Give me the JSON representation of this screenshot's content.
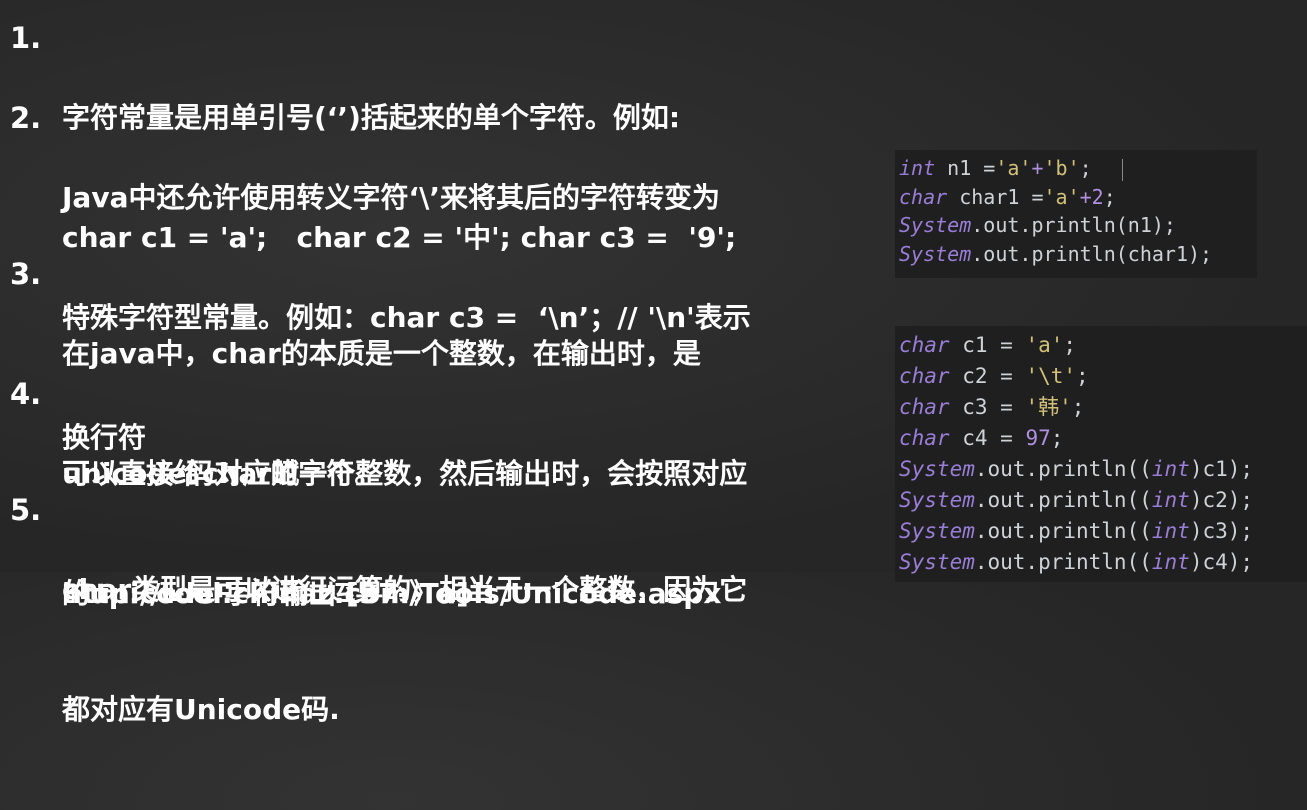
{
  "items": [
    {
      "num": "1.",
      "lines": [
        "字符常量是用单引号(‘’)括起来的单个字符。例如:",
        "char c1 = 'a';   char c2 = '中'; char c3 =  '9';"
      ]
    },
    {
      "num": "2.",
      "lines": [
        "Java中还允许使用转义字符‘\\’来将其后的字符转变为",
        "特殊字符型常量。例如：char c3 =  ‘\\n’；// '\\n'表示",
        "换行符"
      ]
    },
    {
      "num": "3.",
      "lines": [
        "在java中，char的本质是一个整数，在输出时，是",
        "unicode码对应的字符。",
        "http://tool.chinaz.com/Tools/Unicode.aspx"
      ]
    },
    {
      "num": "4.",
      "lines": [
        "可以直接给char赋一个整数，然后输出时，会按照对应",
        "的unicode 字符输出 [97-》a]"
      ]
    },
    {
      "num": "5.",
      "lines": [
        "char类型是可以进行运算的，相当于一个整数，因为它",
        "都对应有Unicode码."
      ]
    }
  ],
  "code_block_1": {
    "l1": {
      "kw": "int",
      "rest1": " n1 =",
      "s1": "'a'",
      "plus": "+",
      "s2": "'b'",
      "end": ";"
    },
    "l2": {
      "kw": "char",
      "rest1": " char1 =",
      "s1": "'a'",
      "plus": "+",
      "n": "2",
      "end": ";"
    },
    "l3": {
      "cls": "System",
      "rest": ".out.println(n1);"
    },
    "l4": {
      "cls": "System",
      "rest": ".out.println(char1);"
    }
  },
  "code_block_2": {
    "decls": [
      {
        "kw": "char",
        "name": " c1 = ",
        "val": "'a'",
        "type": "str"
      },
      {
        "kw": "char",
        "name": " c2 = ",
        "val": "'\\t'",
        "type": "str"
      },
      {
        "kw": "char",
        "name": " c3 = ",
        "val": "'韩'",
        "type": "str"
      },
      {
        "kw": "char",
        "name": " c4 = ",
        "val": "97",
        "type": "num"
      }
    ],
    "prints": [
      {
        "cls": "System",
        "mid": ".out.println((",
        "kw": "int",
        "end": ")c1);"
      },
      {
        "cls": "System",
        "mid": ".out.println((",
        "kw": "int",
        "end": ")c2);"
      },
      {
        "cls": "System",
        "mid": ".out.println((",
        "kw": "int",
        "end": ")c3);"
      },
      {
        "cls": "System",
        "mid": ".out.println((",
        "kw": "int",
        "end": ")c4);"
      }
    ]
  },
  "colors": {
    "keyword": "#9a7dd6",
    "string": "#d2c07a",
    "number": "#b08fe0",
    "text": "#ffffff",
    "background": "#2a2a2a"
  }
}
